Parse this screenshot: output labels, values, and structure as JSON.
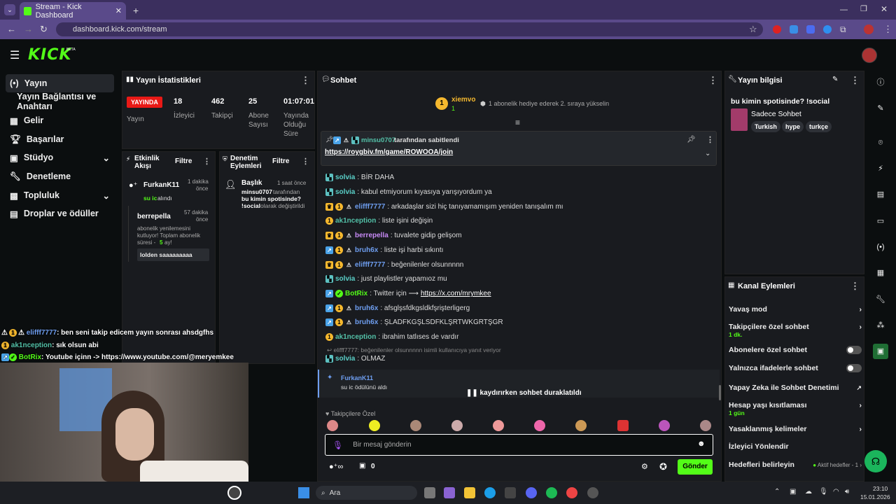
{
  "browser": {
    "tab_title": "Stream - Kick Dashboard",
    "url": "dashboard.kick.com/stream"
  },
  "app": {
    "logo": "KICK",
    "logo_sup": "BETA"
  },
  "sidebar": {
    "items": [
      {
        "label": "Yayın",
        "icon": "broadcast-icon"
      },
      {
        "label": "Yayın Bağlantısı ve Anahtarı",
        "icon": ""
      },
      {
        "label": "Gelir",
        "icon": "revenue-icon"
      },
      {
        "label": "Başarılar",
        "icon": "trophy-icon"
      },
      {
        "label": "Stüdyo",
        "icon": "studio-icon"
      },
      {
        "label": "Denetleme",
        "icon": "wrench-icon"
      },
      {
        "label": "Topluluk",
        "icon": "community-icon"
      },
      {
        "label": "Droplar ve ödüller",
        "icon": "gift-icon"
      }
    ]
  },
  "stats": {
    "title": "Yayın İstatistikleri",
    "live_badge": "YAYINDA",
    "status_label": "Yayın",
    "viewers": "18",
    "viewers_label": "İzleyici",
    "followers": "462",
    "followers_label": "Takipçi",
    "subs": "25",
    "subs_label_1": "Abone",
    "subs_label_2": "Sayısı",
    "uptime": "01:07:01",
    "uptime_label_1": "Yayında",
    "uptime_label_2": "Olduğu",
    "uptime_label_3": "Süre"
  },
  "activity": {
    "title_1": "Etkinlik",
    "title_2": "Akışı",
    "filter": "Filtre",
    "e1_user": "FurkanK11",
    "e1_time_1": "1 dakika",
    "e1_time_2": "önce",
    "e1_desc_green": "su ic",
    "e1_desc": "alındı",
    "e2_user": "berrepella",
    "e2_time_1": "57 dakika",
    "e2_time_2": "önce",
    "e2_msg_1": "abonelik yenilemesini",
    "e2_msg_2": "kutluyor! Toplam abonelik",
    "e2_msg_3": "süresi -",
    "e2_msg_months": "5",
    "e2_msg_4": "ay!",
    "e2_quote": "lolden saaaaaaaaa"
  },
  "moderation": {
    "title_1": "Denetim",
    "title_2": "Eylemleri",
    "filter": "Filtre",
    "m1_title": "Başlık",
    "m1_time": "1 saat önce",
    "m1_user": "minsu0707",
    "m1_text_1": "tarafından",
    "m1_text_2": "bu kimin spotisinde?",
    "m1_text_3": "!social",
    "m1_text_4": "olarak değiştirildi"
  },
  "chat": {
    "title": "Sohbet",
    "top_user": "xiemvo",
    "top_level": "1",
    "top_text": "1 abonelik hediye ederek 2. sıraya yükselin",
    "pinned_by_user": "minsu0707",
    "pinned_by": "tarafından sabitlendi",
    "pinned_link": "https://roygbiv.fm/game/ROWOOA/join",
    "messages": [
      {
        "user": "solvia",
        "text": ": BİR DAHA"
      },
      {
        "user": "solvia",
        "text": ": kabul etmiyorum kıyasıya yarışıyordum ya"
      },
      {
        "user": "elifff7777",
        "text": ": arkadaşlar sizi hiç tanıyamamışım yeniden tanışalım mı"
      },
      {
        "user": "ak1nception",
        "text": ": liste işini değişin"
      },
      {
        "user": "berrepella",
        "text": ": tuvalete gidip gelişom"
      },
      {
        "user": "bruh6x",
        "text": ": liste işi harbi sıkıntı"
      },
      {
        "user": "elifff7777",
        "text": ": beğenilenler olsunnnnn"
      },
      {
        "user": "solvia",
        "text": ": just playlistler yapamıoz mu"
      },
      {
        "user": "BotRix",
        "text": ": Twitter için ⟶ ",
        "link": "https://x.com/mrymkee"
      },
      {
        "user": "bruh6x",
        "text": ": afsglşsfdkgsldkfşrişterligerg"
      },
      {
        "user": "bruh6x",
        "text": ": ŞLADFKGŞLSDFKLŞRTWKGRTŞGR"
      },
      {
        "user": "ak1nception",
        "text": ": ibrahim tatlıses de vardır"
      },
      {
        "user": "solvia",
        "text": ": OLMAZ"
      }
    ],
    "reply_note": "elifff7777: beğenilenler olsunnnnn isimli kullanıcıya yanıt veriyor",
    "redeem_user": "FurkanK11",
    "redeem_text": "su ic ödülünü aldı",
    "paused": "kaydırırken sohbet duraklatıldı",
    "emote_section": "Takipçilere Özel",
    "input_placeholder": "Bir mesaj gönderin",
    "points": "0",
    "send": "Gönder"
  },
  "stream_info": {
    "title": "Yayın bilgisi",
    "stream_title": "bu kimin spotisinde? !social",
    "category": "Sadece Sohbet",
    "tags": [
      "Turkish",
      "hype",
      "turkçe"
    ]
  },
  "channel_actions": {
    "title": "Kanal Eylemleri",
    "slow_mode": "Yavaş mod",
    "followers_only": "Takipçilere özel sohbet",
    "followers_only_sub": "1 dk.",
    "subs_only": "Abonelere özel sohbet",
    "emotes_only": "Yalnızca ifadelerle sohbet",
    "ai_mod": "Yapay Zeka ile Sohbet Denetimi",
    "age_limit": "Hesap yaşı kısıtlaması",
    "age_limit_sub": "1 gün",
    "banned_words": "Yasaklanmış kelimeler",
    "viewer_redirect": "İzleyici Yönlendir",
    "goals": "Hedefleri belirleyin",
    "goals_status": "Aktif hedefler - 1"
  },
  "overlay_chat": [
    {
      "user": "elifff7777",
      "text": ": ben seni takip edicem yayın sonrası ahsdgfhs"
    },
    {
      "user": "ak1nception",
      "text": ": sık olsun abi"
    },
    {
      "user": "BotRix",
      "text": ": Youtube içinn -> https://www.youtube.com/@meryemkee"
    }
  ],
  "taskbar": {
    "search": "Ara",
    "time": "23:10",
    "date": "15.01.2026"
  },
  "colors": {
    "accent": "#53fc18",
    "live": "#e91916",
    "panel": "#191b1f"
  }
}
